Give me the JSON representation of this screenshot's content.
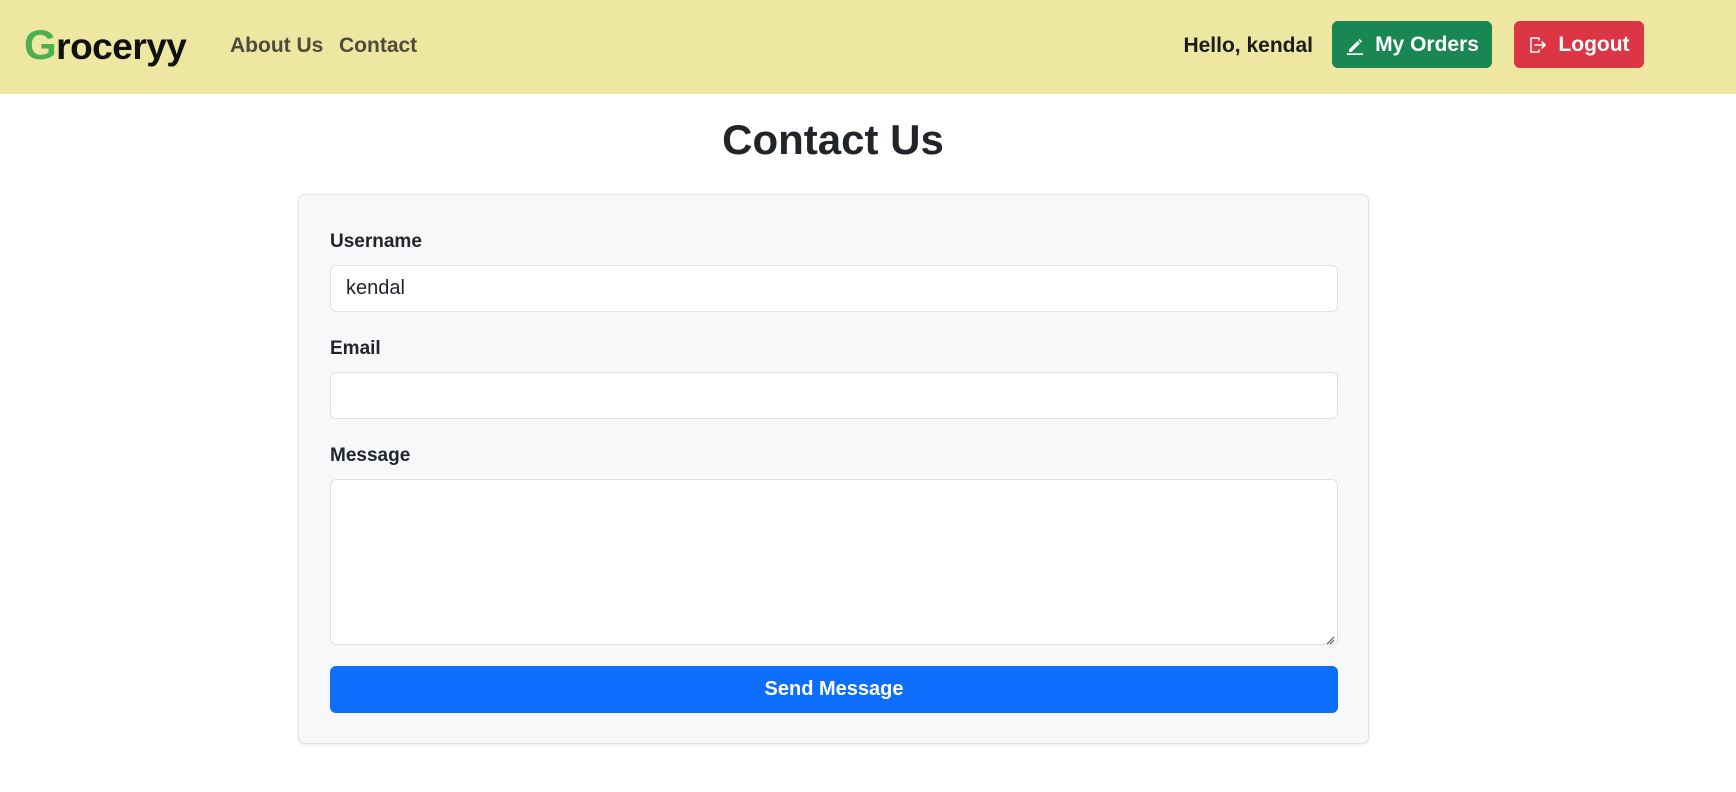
{
  "navbar": {
    "brand_first": "G",
    "brand_rest": "roceryy",
    "links": [
      "About Us",
      "Contact"
    ],
    "greeting": "Hello, kendal",
    "orders_label": "My Orders",
    "logout_label": "Logout",
    "orders_icon": "pencil-icon",
    "logout_icon": "box-arrow-right-icon"
  },
  "main": {
    "title": "Contact Us",
    "form": {
      "username_label": "Username",
      "username_value": "kendal",
      "email_label": "Email",
      "email_value": "",
      "message_label": "Message",
      "message_value": "",
      "submit_label": "Send Message"
    }
  },
  "colors": {
    "navbar_bg": "#ede7a1",
    "brand_accent": "#4caf50",
    "orders_button": "#198754",
    "logout_button": "#dc3545",
    "primary_button": "#0d6efd",
    "card_bg": "#f7f8fa"
  }
}
